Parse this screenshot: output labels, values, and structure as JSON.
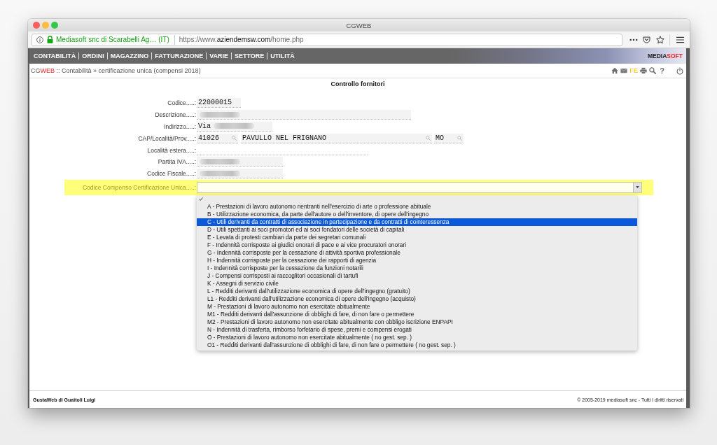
{
  "window": {
    "title": "CGWEB"
  },
  "address_bar": {
    "site_identity": "Mediasoft snc di Scarabelli Ag… (IT)",
    "url": "https://www.**aziendemsw.com**/home.php"
  },
  "nav_menu": {
    "items": [
      "CONTABILITÀ",
      "ORDINI",
      "MAGAZZINO",
      "FATTURAZIONE",
      "VARIE",
      "SETTORE",
      "UTILITÀ"
    ],
    "brand": "MEDIA**SOFT**"
  },
  "breadcrumb": {
    "text": "CG**WEB** :: Contabilità » certificazione unica (compensi 2018)",
    "fe_label": "FE",
    "help_label": "?"
  },
  "form": {
    "title": "Controllo fornitori",
    "fields": [
      {
        "kind": "text",
        "label": "Codice.....:",
        "value": "22000015"
      },
      {
        "kind": "blurred",
        "label": "Descrizione.....:"
      },
      {
        "kind": "partly_blurred",
        "label": "Indirizzo.....:",
        "value": "Via"
      },
      {
        "kind": "lookup",
        "label": "CAP/Località/Prov.....:",
        "parts": [
          "41026",
          "PAVULLO NEL FRIGNANO",
          "MO"
        ]
      },
      {
        "kind": "empty",
        "label": "Località estera.....:"
      },
      {
        "kind": "blurred",
        "label": "Partita IVA.....:"
      },
      {
        "kind": "blurred",
        "label": "Codice Fiscale.....:"
      }
    ]
  },
  "compenso_select": {
    "label": "Codice Compenso Certificazione Unica.....:",
    "highlighted": true,
    "expanded": true,
    "options": [
      {
        "checked": true,
        "highlighted": false
      },
      {
        "label": "A - Prestazioni di lavoro autonomo rientranti nell'esercizio di arte o professione abituale",
        "checked": false,
        "highlighted": false
      },
      {
        "label": "B - Utilizzazione economica, da parte dell'autore o dell'inventore, di opere dell'ingegno",
        "checked": false,
        "highlighted": false
      },
      {
        "label": "C - Utili derivanti da contratti di associazione in partecipazione e da contratti di cointeressenza",
        "checked": false,
        "highlighted": true
      },
      {
        "label": "D - Utili spettanti ai soci promotori ed ai soci fondatori delle società di capitali",
        "checked": false,
        "highlighted": false
      },
      {
        "label": "E - Levata di protesti cambiari da parte dei segretari comunali",
        "checked": false,
        "highlighted": false
      },
      {
        "label": "F - Indennità corrisposte ai giudici onorari di pace e ai vice procuratori onorari",
        "checked": false,
        "highlighted": false
      },
      {
        "label": "G - Indennità corrisposte per la cessazione di attività sportiva professionale",
        "checked": false,
        "highlighted": false
      },
      {
        "label": "H - Indennità corrisposte per la cessazione dei rapporti di agenzia",
        "checked": false,
        "highlighted": false
      },
      {
        "label": "I - Indennità corrisposte per la cessazione da funzioni notarili",
        "checked": false,
        "highlighted": false
      },
      {
        "label": "J - Compensi corrisposti ai raccoglitori occasionali di tartufi",
        "checked": false,
        "highlighted": false
      },
      {
        "label": "K - Assegni di servizio civile",
        "checked": false,
        "highlighted": false
      },
      {
        "label": "L - Redditi derivanti dall'utilizzazione economica di opere dell'ingegno (gratuito)",
        "checked": false,
        "highlighted": false
      },
      {
        "label": "L1 - Redditi derivanti dall'utilizzazione economica di opere dell'ingegno (acquisto)",
        "checked": false,
        "highlighted": false
      },
      {
        "label": "M - Prestazioni di lavoro autonomo non esercitate abitualmente",
        "checked": false,
        "highlighted": false
      },
      {
        "label": "M1 - Redditi derivanti dall'assunzione di obblighi di fare, di non fare o permettere",
        "checked": false,
        "highlighted": false
      },
      {
        "label": "M2 - Prestazioni di lavoro autonomo non esercitate abitualmente con obbligo iscrizione ENPAPI",
        "checked": false,
        "highlighted": false
      },
      {
        "label": "N - Indennità di trasferta, rimborso forfetario di spese, premi e compensi erogati",
        "checked": false,
        "highlighted": false
      },
      {
        "label": "O - Prestazioni di lavoro autonomo non esercitate abitualmente ( no gest. sep. )",
        "checked": false,
        "highlighted": false
      },
      {
        "label": "O1 - Redditi derivanti dall'assunzione di obblighi di fare, di non fare o permettere ( no gest. sep. )",
        "checked": false,
        "highlighted": false
      }
    ]
  },
  "footer": {
    "left": "GustaWeb di Guaitoli Luigi",
    "right": "© 2005-2019 mediasoft snc - Tutti i diritti riservati"
  }
}
